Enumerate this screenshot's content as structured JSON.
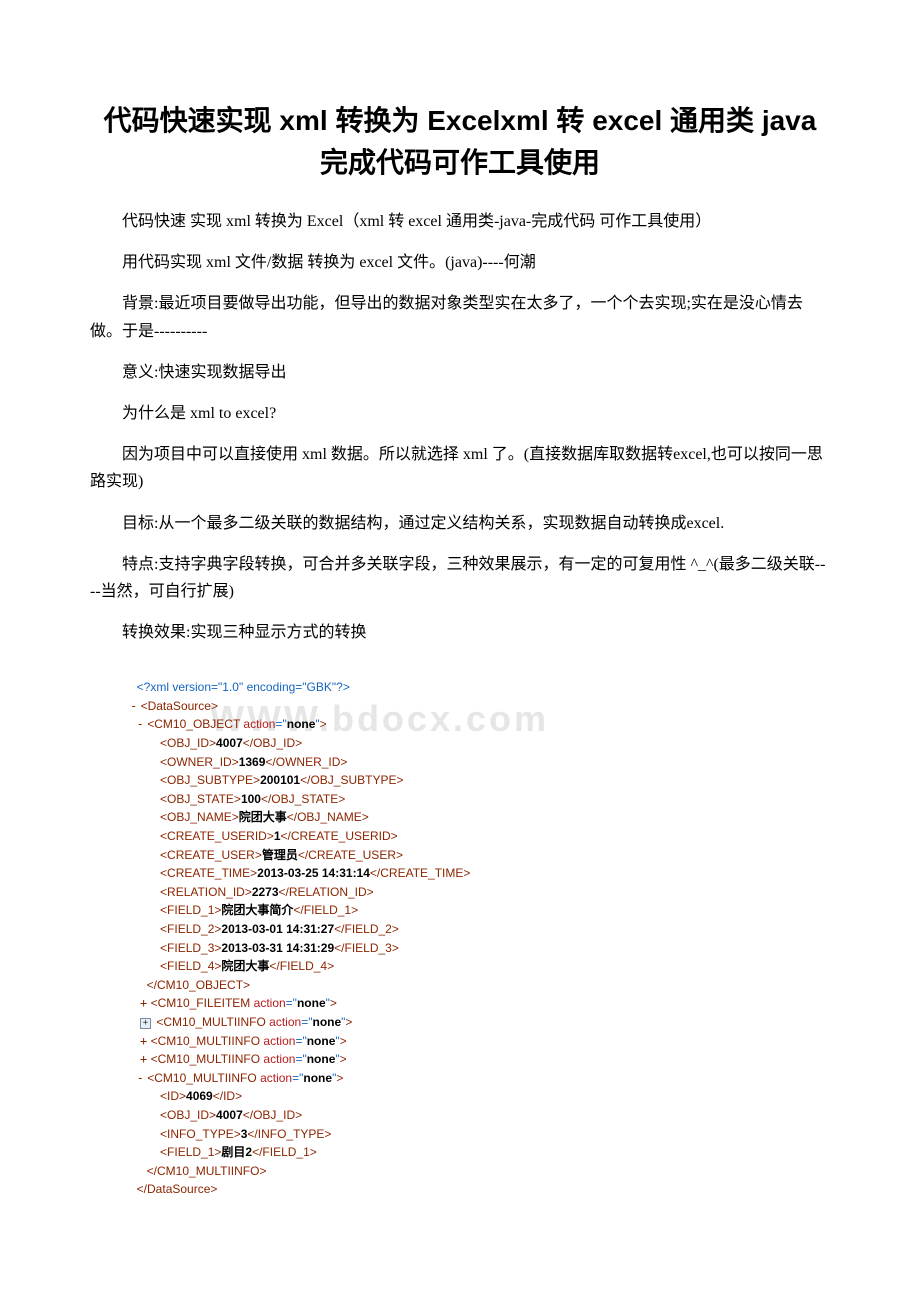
{
  "title": "代码快速实现 xml 转换为 Excelxml 转 excel 通用类 java 完成代码可作工具使用",
  "paras": [
    "代码快速 实现 xml 转换为 Excel（xml 转 excel 通用类-java-完成代码 可作工具使用）",
    "用代码实现 xml 文件/数据 转换为 excel 文件。(java)----何潮",
    "背景:最近项目要做导出功能，但导出的数据对象类型实在太多了，一个个去实现;实在是没心情去做。于是----------",
    "意义:快速实现数据导出",
    "为什么是 xml to excel?",
    "因为项目中可以直接使用 xml 数据。所以就选择 xml 了。(直接数据库取数据转excel,也可以按同一思路实现)",
    "目标:从一个最多二级关联的数据结构，通过定义结构关系，实现数据自动转换成excel.",
    "特点:支持字典字段转换，可合并多关联字段，三种效果展示，有一定的可复用性 ^_^(最多二级关联----当然，可自行扩展)",
    "转换效果:实现三种显示方式的转换"
  ],
  "watermark": "WWW.bdocx.com",
  "xml": {
    "decl": "<?xml version=\"1.0\" encoding=\"GBK\"?>",
    "root_open": "<DataSource>",
    "root_close": "</DataSource>",
    "obj": {
      "open_tag": "CM10_OBJECT",
      "attr_name": "action",
      "attr_val": "none",
      "fields": [
        {
          "tag": "OBJ_ID",
          "val": "4007"
        },
        {
          "tag": "OWNER_ID",
          "val": "1369"
        },
        {
          "tag": "OBJ_SUBTYPE",
          "val": "200101"
        },
        {
          "tag": "OBJ_STATE",
          "val": "100"
        },
        {
          "tag": "OBJ_NAME",
          "val": "院团大事"
        },
        {
          "tag": "CREATE_USERID",
          "val": "1"
        },
        {
          "tag": "CREATE_USER",
          "val": "管理员"
        },
        {
          "tag": "CREATE_TIME",
          "val": "2013-03-25 14:31:14"
        },
        {
          "tag": "RELATION_ID",
          "val": "2273"
        },
        {
          "tag": "FIELD_1",
          "val": "院团大事简介"
        },
        {
          "tag": "FIELD_2",
          "val": "2013-03-01 14:31:27"
        },
        {
          "tag": "FIELD_3",
          "val": "2013-03-31 14:31:29"
        },
        {
          "tag": "FIELD_4",
          "val": "院团大事"
        }
      ],
      "close": "</CM10_OBJECT>"
    },
    "collapsed": [
      {
        "tag": "CM10_FILEITEM",
        "attr_name": "action",
        "attr_val": "none",
        "toggle": "+"
      },
      {
        "tag": "CM10_MULTIINFO",
        "attr_name": "action",
        "attr_val": "none",
        "toggle": "box"
      },
      {
        "tag": "CM10_MULTIINFO",
        "attr_name": "action",
        "attr_val": "none",
        "toggle": "+"
      },
      {
        "tag": "CM10_MULTIINFO",
        "attr_name": "action",
        "attr_val": "none",
        "toggle": "+"
      }
    ],
    "multi": {
      "open_tag": "CM10_MULTIINFO",
      "attr_name": "action",
      "attr_val": "none",
      "fields": [
        {
          "tag": "ID",
          "val": "4069"
        },
        {
          "tag": "OBJ_ID",
          "val": "4007"
        },
        {
          "tag": "INFO_TYPE",
          "val": "3"
        },
        {
          "tag": "FIELD_1",
          "val": "剧目2"
        }
      ],
      "close": "</CM10_MULTIINFO>"
    }
  }
}
